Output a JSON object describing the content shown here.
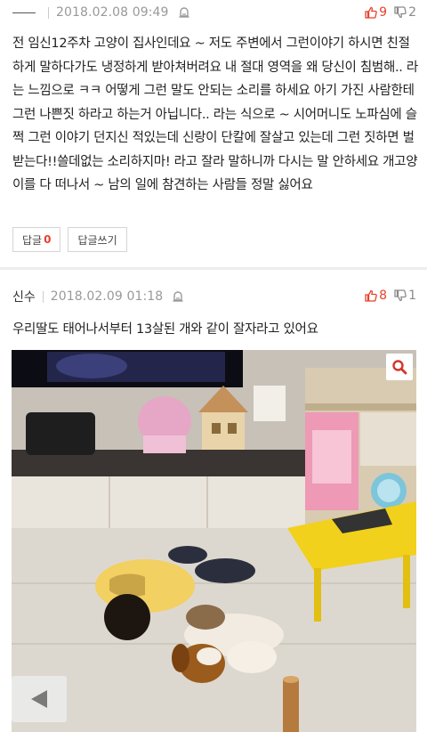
{
  "comments": [
    {
      "date": "2018.02.08 09:49",
      "upvotes": "9",
      "downvotes": "2",
      "text": "전 임신12주차 고양이 집사인데요 ~ 저도 주변에서 그런이야기 하시면 친절하게 말하다가도 냉정하게 받아쳐버려요 내 절대 영역을 왜 당신이 침범해.. 라는 느낌으로 ㅋㅋ 어떻게 그런 말도 안되는 소리를 하세요 아기 가진 사람한테 그런 나쁜짓 하라고 하는거 아닙니다.. 라는 식으로 ~ 시어머니도 노파심에 슬쩍 그런 이야기 던지신 적있는데 신랑이 단칼에 잘살고 있는데 그런 짓하면 벌받는다!!쓸데없는 소리하지마! 라고 잘라 말하니까 다시는 말 안하세요 개고양이를 다 떠나서 ~ 남의 일에 참견하는 사람들 정말 싫어요",
      "reply_label": "답글",
      "reply_count": "0",
      "write_reply_label": "답글쓰기"
    },
    {
      "author": "신수",
      "date": "2018.02.09 01:18",
      "upvotes": "8",
      "downvotes": "1",
      "text": "우리딸도 태어나서부터 13살된 개와 같이 잘자라고 있어요"
    }
  ],
  "icons": {
    "report": "report-icon",
    "upvote": "thumbs-up-icon",
    "downvote": "thumbs-down-icon",
    "search": "search-icon",
    "back": "back-arrow-icon"
  },
  "colors": {
    "upvote": "#e8412c",
    "downvote": "#8a8a8a",
    "search": "#d4352b"
  }
}
